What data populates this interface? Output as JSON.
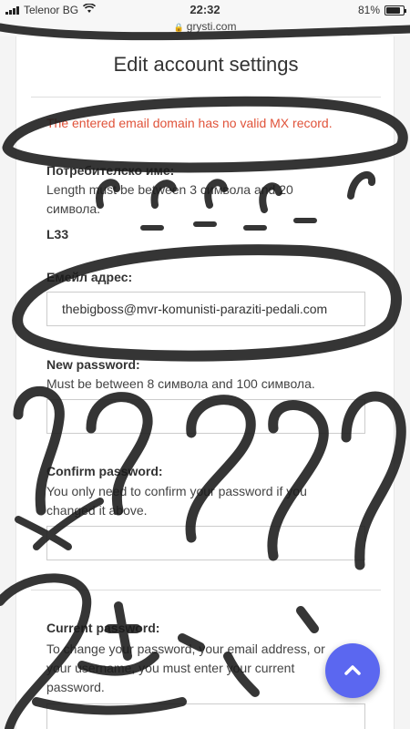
{
  "status_bar": {
    "carrier": "Telenor BG",
    "time": "22:32",
    "battery": "81%",
    "battery_level": 0.81
  },
  "browser": {
    "url": "grysti.com"
  },
  "page": {
    "title": "Edit account settings",
    "error": "The entered email domain has no valid MX record."
  },
  "form": {
    "username": {
      "label": "Потребителско име:",
      "help": "Length must be between 3 символа and 20 символа.",
      "value": "L33"
    },
    "email": {
      "label": "Емейл адрес:",
      "value": "thebigboss@mvr-komunisti-paraziti-pedali.com"
    },
    "new_password": {
      "label": "New password:",
      "help": "Must be between 8 символа and 100 символа.",
      "value": ""
    },
    "confirm_password": {
      "label": "Confirm password:",
      "help": "You only need to confirm your password if you changed it above.",
      "value": ""
    },
    "current_password": {
      "label": "Current password:",
      "help": "To change your password, your email address, or your username, you must enter your current password.",
      "value": ""
    }
  },
  "icons": {
    "scroll_top": "chevron-up-icon",
    "lock": "lock-icon",
    "wifi": "wifi-icon",
    "signal": "signal-icon",
    "battery": "battery-icon"
  },
  "colors": {
    "error": "#e0533a",
    "fab": "#5b67f0",
    "scribble": "#1a1a1a"
  }
}
